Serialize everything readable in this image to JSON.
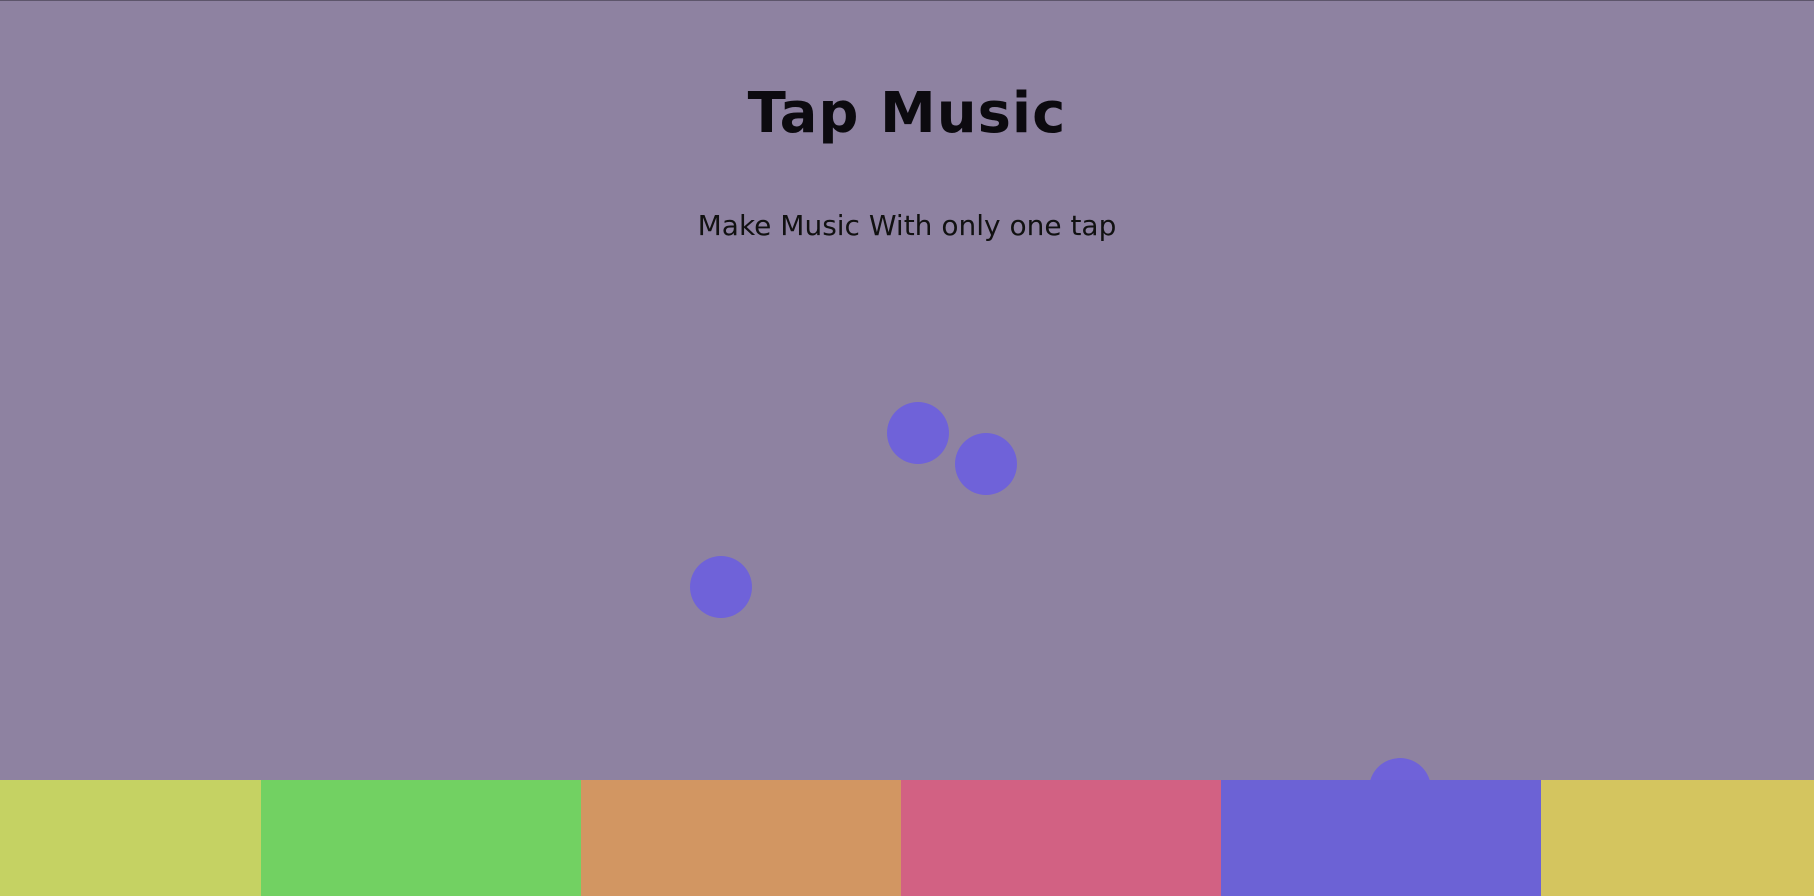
{
  "header": {
    "title": "Tap Music",
    "subtitle": "Make Music With only one tap"
  },
  "colors": {
    "background": "#8e82a1",
    "ball": "#6f62d9"
  },
  "pads": [
    {
      "name": "pad-1",
      "color": "#c5d263"
    },
    {
      "name": "pad-2",
      "color": "#72d162"
    },
    {
      "name": "pad-3",
      "color": "#d29662"
    },
    {
      "name": "pad-4",
      "color": "#d26183"
    },
    {
      "name": "pad-5",
      "color": "#6c62d5"
    },
    {
      "name": "pad-6",
      "color": "#d4c55f"
    }
  ],
  "balls_count": 4
}
